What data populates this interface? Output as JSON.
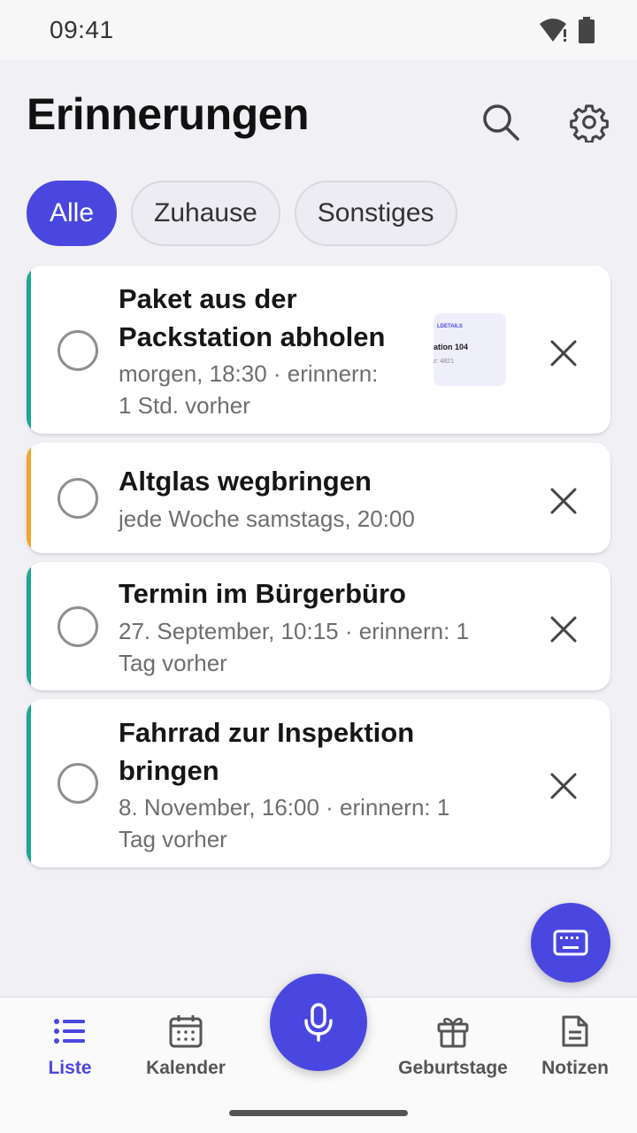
{
  "status_bar": {
    "time": "09:41",
    "icons": [
      "wifi-icon",
      "battery-icon"
    ]
  },
  "header": {
    "title": "Erinnerungen",
    "search_icon": "search-icon",
    "settings_icon": "gear-icon"
  },
  "filters": [
    {
      "label": "Alle",
      "active": true
    },
    {
      "label": "Zuhause",
      "active": false
    },
    {
      "label": "Sonstiges",
      "active": false
    }
  ],
  "reminders": [
    {
      "title_lines": [
        "Paket aus der",
        "Packstation abholen"
      ],
      "sub_lines": [
        "morgen, 18:30 · erinnern:",
        "1 Std. vorher"
      ],
      "stripe_color": "#1aa894",
      "thumbnail": {
        "line1": "LDETAILS",
        "line2": "ation 104",
        "line3": "z: 4821"
      }
    },
    {
      "title_lines": [
        "Altglas wegbringen"
      ],
      "sub_lines": [
        "jede Woche samstags, 20:00"
      ],
      "stripe_color": "#f2a52b"
    },
    {
      "title_lines": [
        "Termin im Bürgerbüro"
      ],
      "sub_lines": [
        "27. September, 10:15 · erinnern: 1",
        "Tag vorher"
      ],
      "stripe_color": "#1aa894"
    },
    {
      "title_lines": [
        "Fahrrad zur Inspektion",
        "bringen"
      ],
      "sub_lines": [
        "8. November, 16:00 · erinnern: 1",
        "Tag vorher"
      ],
      "stripe_color": "#1aa894"
    }
  ],
  "fab": {
    "icon": "keyboard-icon"
  },
  "bottom_nav": {
    "items": [
      {
        "label": "Liste",
        "icon": "list-icon",
        "active": true
      },
      {
        "label": "Kalender",
        "icon": "calendar-icon",
        "active": false
      },
      {
        "label": "Geburtstage",
        "icon": "gift-icon",
        "active": false
      },
      {
        "label": "Notizen",
        "icon": "note-icon",
        "active": false
      }
    ],
    "center_icon": "microphone-icon"
  },
  "colors": {
    "accent": "#4a47e0",
    "teal": "#1aa894",
    "orange": "#f2a52b"
  }
}
